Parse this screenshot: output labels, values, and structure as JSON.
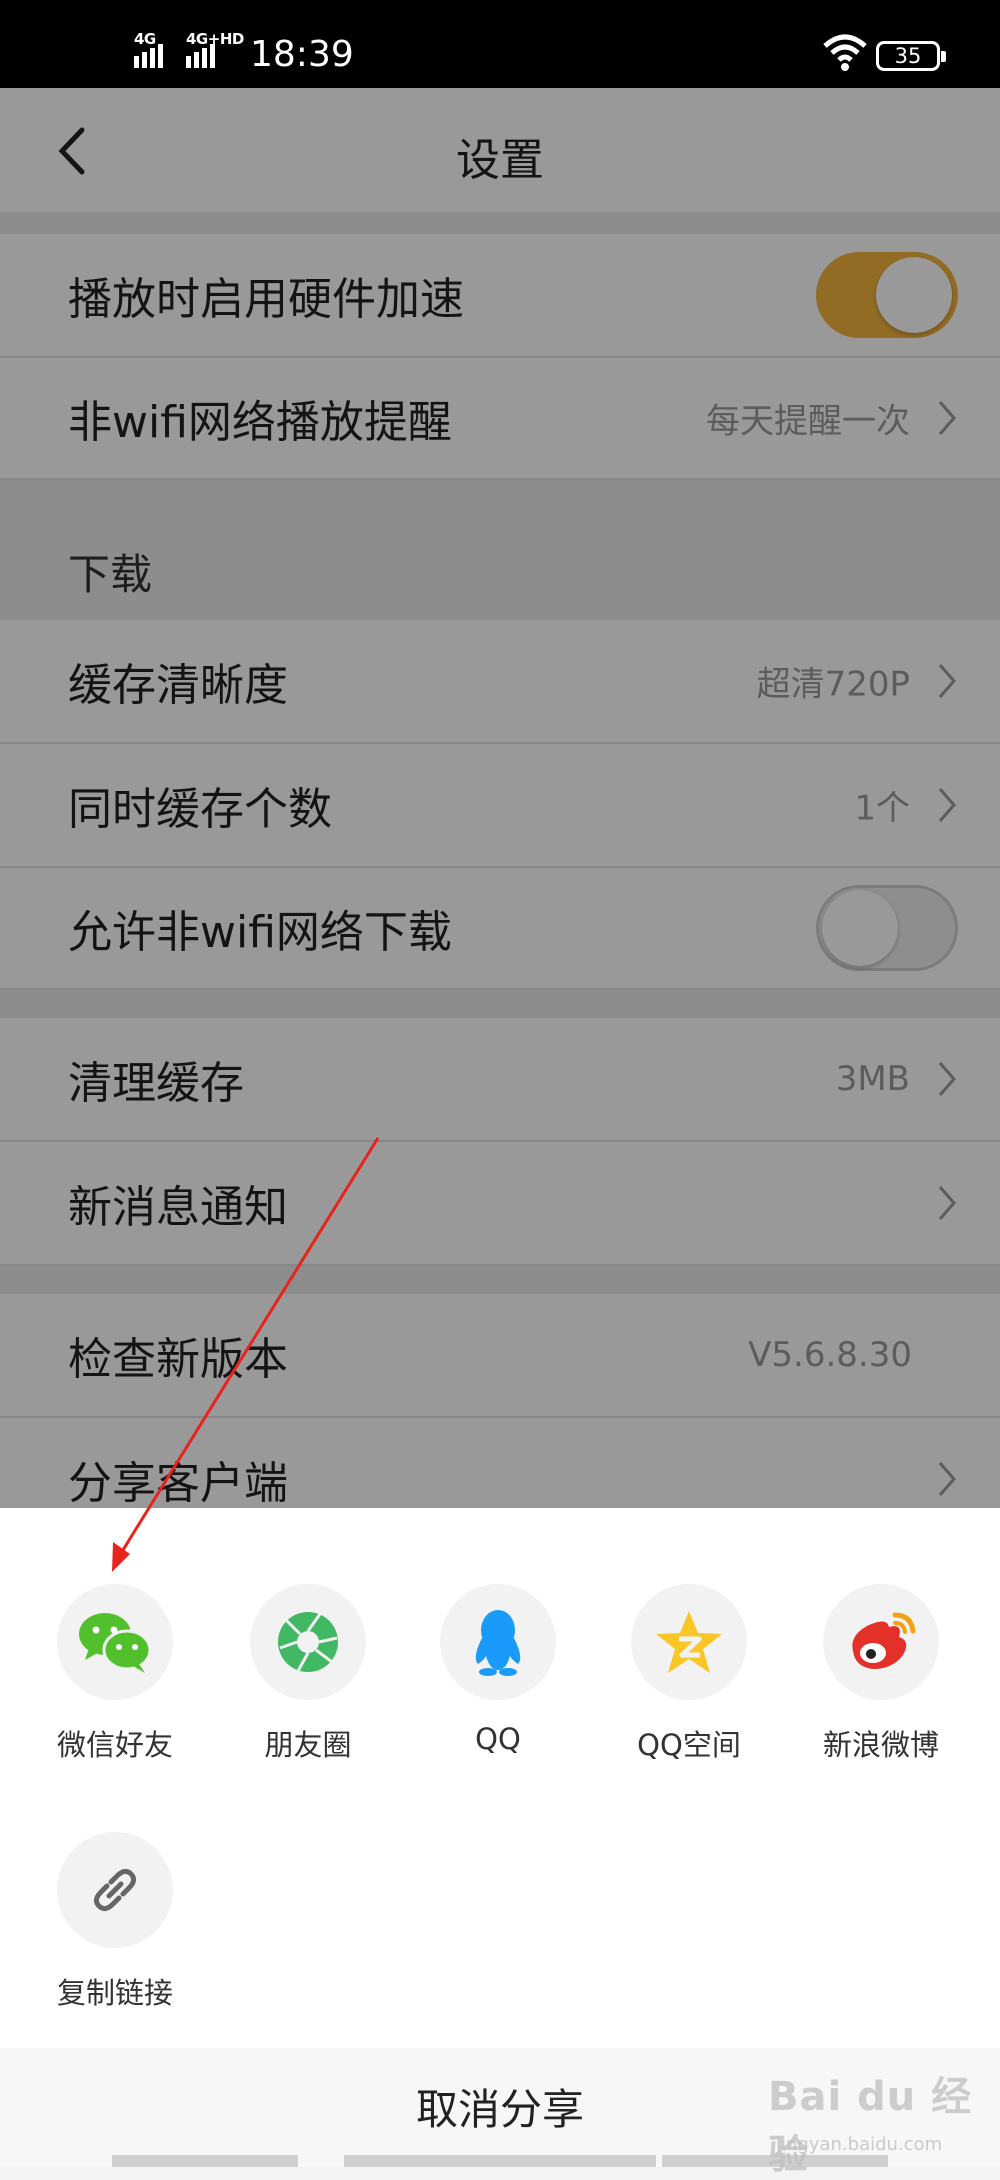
{
  "status_bar": {
    "signal_1": "4G",
    "signal_2": "4G+HD",
    "time": "18:39",
    "battery": "35"
  },
  "nav": {
    "title": "设置",
    "back_icon": "chevron-left-icon"
  },
  "settings": {
    "hw_accel": {
      "label": "播放时启用硬件加速",
      "enabled": true
    },
    "non_wifi_play": {
      "label": "非wifi网络播放提醒",
      "value": "每天提醒一次"
    },
    "download_section": "下载",
    "cache_quality": {
      "label": "缓存清晰度",
      "value": "超清720P"
    },
    "concurrent_cache": {
      "label": "同时缓存个数",
      "value": "1个"
    },
    "non_wifi_download": {
      "label": "允许非wifi网络下载",
      "enabled": false
    },
    "clear_cache": {
      "label": "清理缓存",
      "value": "3MB"
    },
    "notifications": {
      "label": "新消息通知"
    },
    "check_version": {
      "label": "检查新版本",
      "value": "V5.6.8.30"
    },
    "share_client": {
      "label": "分享客户端"
    }
  },
  "share_sheet": {
    "items": [
      {
        "label": "微信好友",
        "icon": "wechat-icon"
      },
      {
        "label": "朋友圈",
        "icon": "moments-icon"
      },
      {
        "label": "QQ",
        "icon": "qq-icon"
      },
      {
        "label": "QQ空间",
        "icon": "qzone-icon"
      },
      {
        "label": "新浪微博",
        "icon": "weibo-icon"
      },
      {
        "label": "复制链接",
        "icon": "link-icon"
      }
    ],
    "cancel": "取消分享"
  },
  "watermark": {
    "main": "Bai du 经验",
    "sub": "jingyan.baidu.com"
  },
  "colors": {
    "toggle_on": "#f4b43f",
    "wechat_green": "#52c02c",
    "moments_green": "#41b863",
    "qq_blue": "#1a9bfb",
    "qzone_yellow": "#f9c625",
    "weibo_red": "#e3312a",
    "arrow_red": "#e8231c"
  }
}
